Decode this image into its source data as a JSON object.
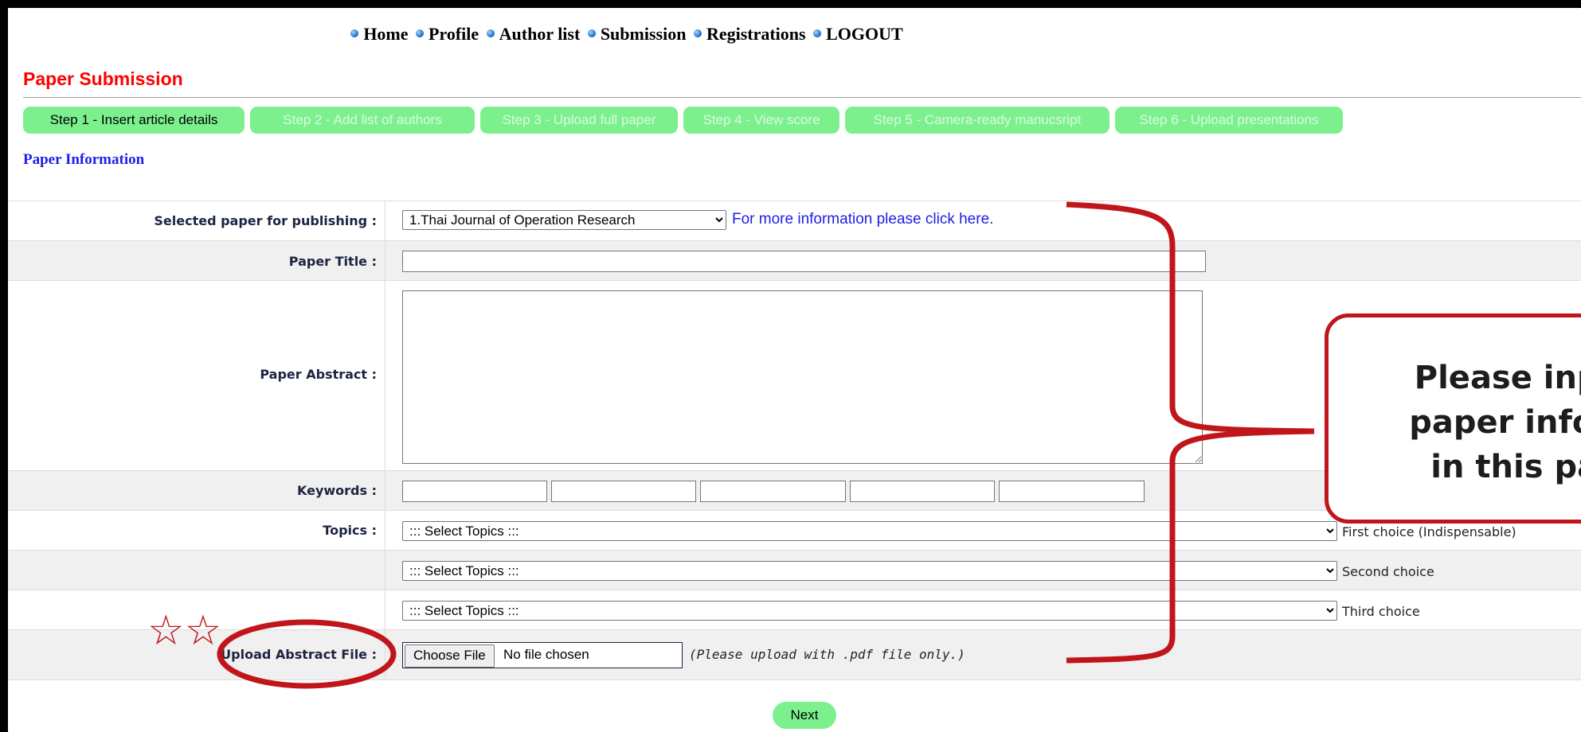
{
  "nav": {
    "items": [
      "Home",
      "Profile",
      "Author list",
      "Submission",
      "Registrations",
      "LOGOUT"
    ]
  },
  "page": {
    "title": "Paper Submission",
    "section": "Paper Information"
  },
  "steps": [
    {
      "label": "Step 1 - Insert article details",
      "active": true
    },
    {
      "label": "Step 2 - Add list of authors",
      "active": false
    },
    {
      "label": "Step 3 - Upload full paper",
      "active": false
    },
    {
      "label": "Step 4 - View score",
      "active": false
    },
    {
      "label": "Step 5 - Camera-ready manucsript",
      "active": false
    },
    {
      "label": "Step 6 - Upload presentations",
      "active": false
    }
  ],
  "form": {
    "journal": {
      "label": "Selected paper for publishing :",
      "value": "1.Thai Journal of Operation Research",
      "info_link": "For more information please click here",
      "info_suffix": "."
    },
    "title": {
      "label": "Paper Title :",
      "value": ""
    },
    "abstract": {
      "label": "Paper Abstract :",
      "value": ""
    },
    "keywords": {
      "label": "Keywords :",
      "values": [
        "",
        "",
        "",
        "",
        ""
      ]
    },
    "topics": {
      "label": "Topics :",
      "placeholder": "::: Select Topics :::",
      "choices": [
        "First choice (Indispensable)",
        "Second choice",
        "Third choice"
      ]
    },
    "upload": {
      "label": "Upload Abstract File :",
      "button": "Choose File",
      "status": "No file chosen",
      "note": "(Please upload with .pdf file only.)"
    },
    "next_button": "Next"
  },
  "annotation": {
    "callout_lines": [
      "Please input",
      "paper inform",
      "in this pag"
    ],
    "stars": "☆☆",
    "color": "#c0161b"
  }
}
